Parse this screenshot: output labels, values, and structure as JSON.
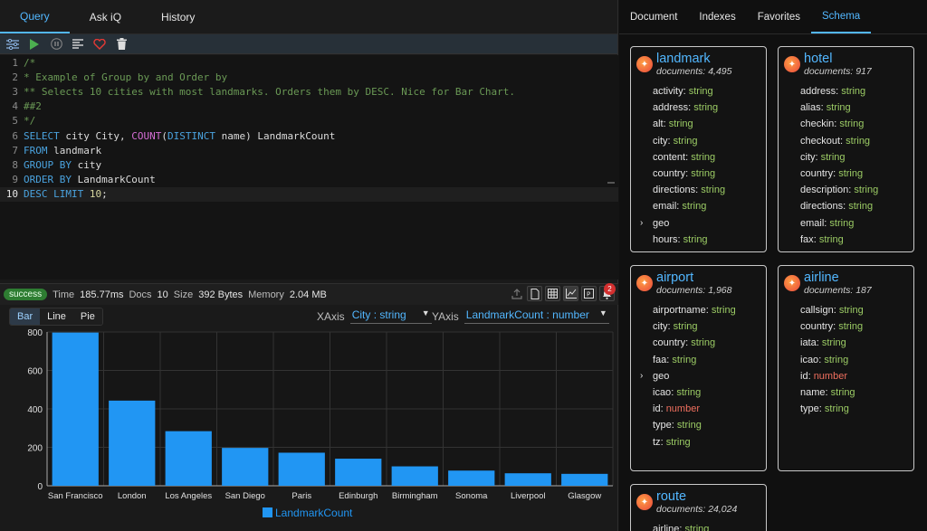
{
  "left_tabs": [
    "Query",
    "Ask iQ",
    "History"
  ],
  "editor": {
    "lines": [
      {
        "n": "1",
        "parts": [
          {
            "t": "/*",
            "c": "c-com"
          }
        ]
      },
      {
        "n": "2",
        "parts": [
          {
            "t": "* Example of Group by and Order by",
            "c": "c-com"
          }
        ]
      },
      {
        "n": "3",
        "parts": [
          {
            "t": "** Selects 10 cities with most landmarks. Orders them by DESC. Nice for Bar Chart.",
            "c": "c-com"
          }
        ]
      },
      {
        "n": "4",
        "parts": [
          {
            "t": "##2",
            "c": "c-com"
          }
        ]
      },
      {
        "n": "5",
        "parts": [
          {
            "t": "*/",
            "c": "c-com"
          }
        ]
      },
      {
        "n": "6",
        "parts": [
          {
            "t": "SELECT",
            "c": "c-kw"
          },
          {
            "t": " city City, ",
            "c": ""
          },
          {
            "t": "COUNT",
            "c": "c-fn"
          },
          {
            "t": "(",
            "c": ""
          },
          {
            "t": "DISTINCT",
            "c": "c-kw"
          },
          {
            "t": " name) LandmarkCount",
            "c": ""
          }
        ]
      },
      {
        "n": "7",
        "parts": [
          {
            "t": "FROM",
            "c": "c-kw"
          },
          {
            "t": " landmark",
            "c": ""
          }
        ]
      },
      {
        "n": "8",
        "parts": [
          {
            "t": "GROUP BY",
            "c": "c-kw"
          },
          {
            "t": " city",
            "c": ""
          }
        ]
      },
      {
        "n": "9",
        "parts": [
          {
            "t": "ORDER BY",
            "c": "c-kw"
          },
          {
            "t": " LandmarkCount",
            "c": ""
          }
        ]
      },
      {
        "n": "10",
        "parts": [
          {
            "t": "DESC LIMIT",
            "c": "c-kw"
          },
          {
            "t": " ",
            "c": ""
          },
          {
            "t": "10",
            "c": "c-num"
          },
          {
            "t": ";",
            "c": ""
          }
        ]
      }
    ]
  },
  "status": {
    "badge": "success",
    "time_label": "Time",
    "time": "185.77ms",
    "docs_label": "Docs",
    "docs": "10",
    "size_label": "Size",
    "size": "392 Bytes",
    "memory_label": "Memory",
    "memory": "2.04 MB",
    "notifications": "2"
  },
  "chart_controls": {
    "types": [
      "Bar",
      "Line",
      "Pie"
    ],
    "xaxis_label": "XAxis",
    "xaxis_value": "City : string",
    "yaxis_label": "YAxis",
    "yaxis_value": "LandmarkCount : number"
  },
  "chart_data": {
    "type": "bar",
    "categories": [
      "San Francisco",
      "London",
      "Los Angeles",
      "San Diego",
      "Paris",
      "Edinburgh",
      "Birmingham",
      "Sonoma",
      "Liverpool",
      "Glasgow"
    ],
    "series": [
      {
        "name": "LandmarkCount",
        "values": [
          797,
          443,
          284,
          197,
          172,
          141,
          101,
          79,
          65,
          62
        ],
        "color": "#2196f3"
      }
    ],
    "ylim": [
      0,
      800
    ],
    "yticks": [
      0,
      200,
      400,
      600,
      800
    ],
    "grid": true,
    "legend": "bottom"
  },
  "right_tabs": [
    "Document",
    "Indexes",
    "Favorites",
    "Schema"
  ],
  "schema": [
    {
      "name": "landmark",
      "docs": "documents: 4,495",
      "fields": [
        {
          "name": "activity",
          "type": "string"
        },
        {
          "name": "address",
          "type": "string"
        },
        {
          "name": "alt",
          "type": "string"
        },
        {
          "name": "city",
          "type": "string"
        },
        {
          "name": "content",
          "type": "string"
        },
        {
          "name": "country",
          "type": "string"
        },
        {
          "name": "directions",
          "type": "string"
        },
        {
          "name": "email",
          "type": "string"
        },
        {
          "name": "geo",
          "type": "",
          "expand": true
        },
        {
          "name": "hours",
          "type": "string"
        }
      ]
    },
    {
      "name": "hotel",
      "docs": "documents: 917",
      "fields": [
        {
          "name": "address",
          "type": "string"
        },
        {
          "name": "alias",
          "type": "string"
        },
        {
          "name": "checkin",
          "type": "string"
        },
        {
          "name": "checkout",
          "type": "string"
        },
        {
          "name": "city",
          "type": "string"
        },
        {
          "name": "country",
          "type": "string"
        },
        {
          "name": "description",
          "type": "string"
        },
        {
          "name": "directions",
          "type": "string"
        },
        {
          "name": "email",
          "type": "string"
        },
        {
          "name": "fax",
          "type": "string"
        }
      ]
    },
    {
      "name": "airport",
      "docs": "documents: 1,968",
      "fields": [
        {
          "name": "airportname",
          "type": "string"
        },
        {
          "name": "city",
          "type": "string"
        },
        {
          "name": "country",
          "type": "string"
        },
        {
          "name": "faa",
          "type": "string"
        },
        {
          "name": "geo",
          "type": "",
          "expand": true
        },
        {
          "name": "icao",
          "type": "string"
        },
        {
          "name": "id",
          "type": "number"
        },
        {
          "name": "type",
          "type": "string"
        },
        {
          "name": "tz",
          "type": "string"
        }
      ]
    },
    {
      "name": "airline",
      "docs": "documents: 187",
      "fields": [
        {
          "name": "callsign",
          "type": "string"
        },
        {
          "name": "country",
          "type": "string"
        },
        {
          "name": "iata",
          "type": "string"
        },
        {
          "name": "icao",
          "type": "string"
        },
        {
          "name": "id",
          "type": "number"
        },
        {
          "name": "name",
          "type": "string"
        },
        {
          "name": "type",
          "type": "string"
        }
      ]
    },
    {
      "name": "route",
      "docs": "documents: 24,024",
      "fields": [
        {
          "name": "airline",
          "type": "string"
        }
      ]
    }
  ]
}
